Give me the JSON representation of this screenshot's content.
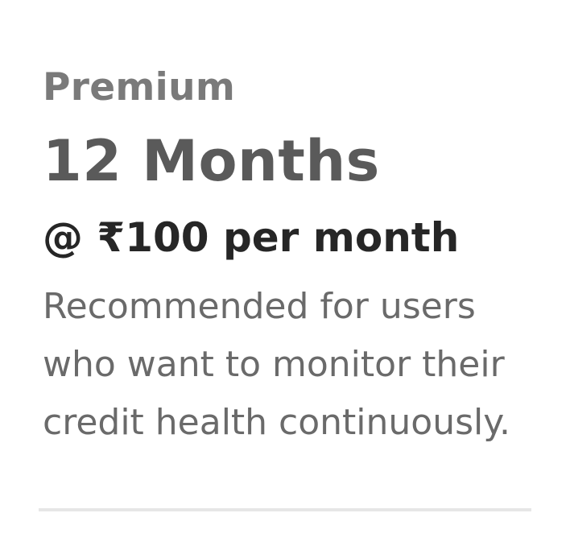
{
  "plan": {
    "tier": "Premium",
    "duration": "12 Months",
    "price": "@ ₹100 per month",
    "description": "Recommended for users who want to monitor their credit health continuously."
  },
  "colors": {
    "tier_text": "#7a7a7a",
    "duration_text": "#5a5a5a",
    "price_text": "#262626",
    "description_text": "#6a6a6a",
    "divider": "#e6e6e6",
    "background": "#ffffff"
  }
}
